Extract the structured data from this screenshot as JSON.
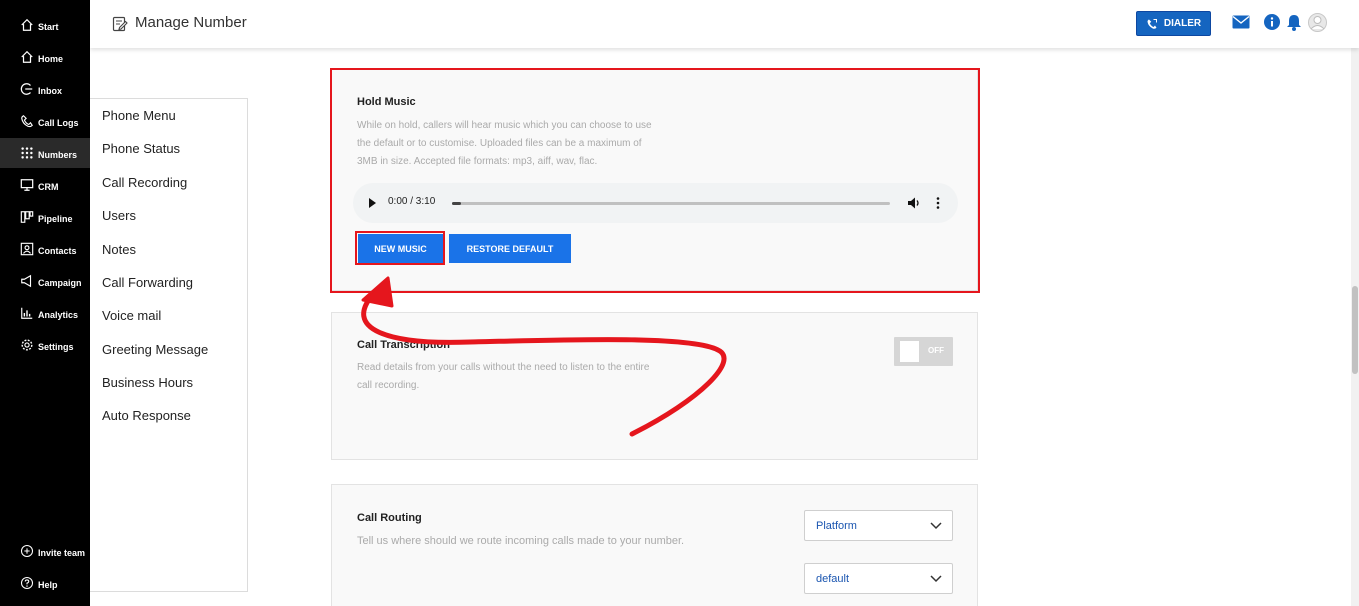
{
  "nav": {
    "items": [
      {
        "label": "Start",
        "icon": "home-outline-icon"
      },
      {
        "label": "Home",
        "icon": "home-icon"
      },
      {
        "label": "Inbox",
        "icon": "inbox-icon"
      },
      {
        "label": "Call Logs",
        "icon": "phone-icon"
      },
      {
        "label": "Numbers",
        "icon": "keypad-icon"
      },
      {
        "label": "CRM",
        "icon": "monitor-icon"
      },
      {
        "label": "Pipeline",
        "icon": "pipeline-icon"
      },
      {
        "label": "Contacts",
        "icon": "contacts-icon"
      },
      {
        "label": "Campaign",
        "icon": "megaphone-icon"
      },
      {
        "label": "Analytics",
        "icon": "chart-icon"
      },
      {
        "label": "Settings",
        "icon": "gear-icon"
      }
    ],
    "bottom": [
      {
        "label": "Invite team",
        "icon": "plus-circle-icon"
      },
      {
        "label": "Help",
        "icon": "help-icon"
      }
    ],
    "active": "Numbers"
  },
  "header": {
    "title": "Manage Number",
    "dialer_label": "DIALER",
    "accent": "#1565c0"
  },
  "side_menu": {
    "items": [
      "Phone Menu",
      "Phone Status",
      "Call Recording",
      "Users",
      "Notes",
      "Call Forwarding",
      "Voice mail",
      "Greeting Message",
      "Business Hours",
      "Auto Response"
    ]
  },
  "hold_music": {
    "title": "Hold Music",
    "desc_lines": [
      "While on hold, callers will hear music which you can choose to use",
      "the default or to customise. Uploaded files can be a maximum of",
      "3MB in size. Accepted file formats: mp3, aiff, wav, flac."
    ],
    "audio_time": "0:00 / 3:10",
    "new_music_label": "NEW MUSIC",
    "restore_label": "RESTORE DEFAULT"
  },
  "call_transcription": {
    "title": "Call Transcription",
    "desc_lines": [
      "Read details from your calls without the need to listen to the entire",
      "call recording."
    ],
    "toggle_label": "OFF"
  },
  "call_routing": {
    "title": "Call Routing",
    "desc": "Tell us where should we route incoming calls made to your number.",
    "select1_value": "Platform",
    "select2_value": "default"
  },
  "colors": {
    "highlight": "#e5161d",
    "button": "#1a73e8"
  }
}
